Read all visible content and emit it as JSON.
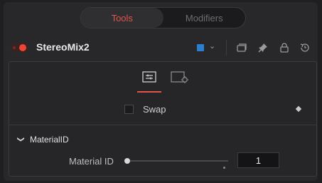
{
  "tabs": [
    {
      "label": "Tools",
      "active": true
    },
    {
      "label": "Modifiers",
      "active": false
    }
  ],
  "node": {
    "name": "StereoMix2",
    "enabled": true,
    "color_chip": "#2b7fd0",
    "header_icons": [
      "chevron-down-icon",
      "version-icon",
      "pin-icon",
      "lock-icon",
      "reset-icon"
    ]
  },
  "control_tabs": [
    {
      "icon": "controls-tab-icon",
      "active": true
    },
    {
      "icon": "settings-tab-icon",
      "active": false
    }
  ],
  "swap": {
    "label": "Swap",
    "checked": false
  },
  "section": {
    "title": "MaterialID",
    "expanded": true
  },
  "material_id": {
    "label": "Material ID",
    "value": "1"
  },
  "colors": {
    "accent": "#e1544a",
    "toggle_on": "#ee4433"
  }
}
